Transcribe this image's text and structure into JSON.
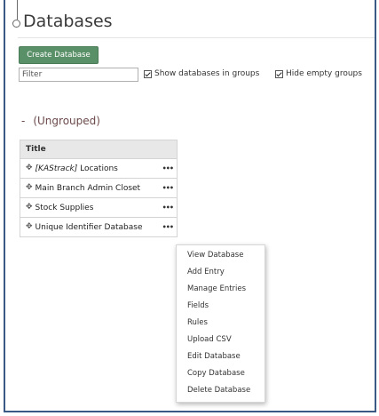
{
  "page": {
    "title": "Databases"
  },
  "toolbar": {
    "create_label": "Create Database",
    "filter_placeholder": "Filter",
    "show_groups_label": "Show databases in groups",
    "hide_empty_label": "Hide empty groups"
  },
  "group": {
    "collapse_symbol": "-",
    "name": "(Ungrouped)"
  },
  "table": {
    "column_title": "Title",
    "rows": [
      {
        "prefix": "[KAStrack]",
        "name": " Locations"
      },
      {
        "prefix": "",
        "name": "Main Branch Admin Closet"
      },
      {
        "prefix": "",
        "name": "Stock Supplies"
      },
      {
        "prefix": "",
        "name": "Unique Identifier Database"
      }
    ],
    "more_symbol": "•••",
    "move_symbol": "✥"
  },
  "context_menu": {
    "items": [
      "View Database",
      "Add Entry",
      "Manage Entries",
      "Fields",
      "Rules",
      "Upload CSV",
      "Edit Database",
      "Copy Database",
      "Delete Database"
    ]
  },
  "colors": {
    "frame_border": "#3a5a85",
    "primary_button": "#5a9068",
    "group_header": "#6b4a4a",
    "table_header_bg": "#e8e8e8"
  }
}
